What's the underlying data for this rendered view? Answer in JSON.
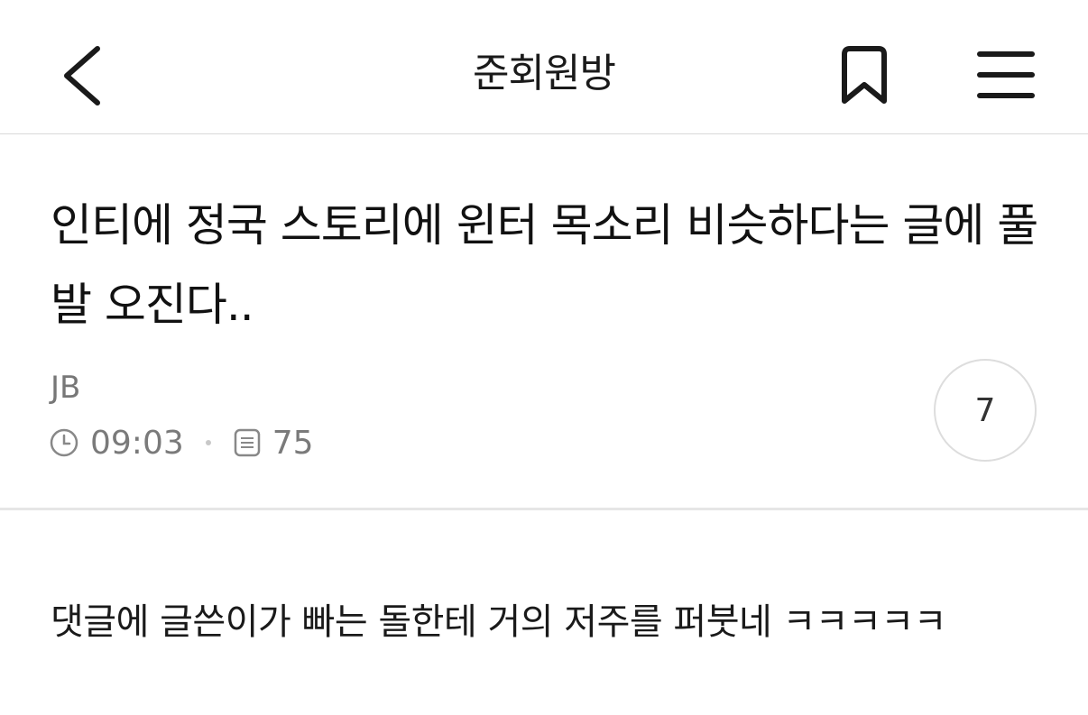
{
  "header": {
    "title": "준회원방",
    "icons": {
      "back": "chevron-left-icon",
      "bookmark": "bookmark-icon",
      "menu": "hamburger-menu-icon"
    }
  },
  "post": {
    "title": "인티에 정국 스토리에 윈터 목소리 비슷하다는 글에 풀발 오진다..",
    "author": "JB",
    "time": "09:03",
    "views": "75",
    "comment_count": "7",
    "body": "댓글에 글쓴이가 빠는 돌한테 거의 저주를 퍼붓네 ㅋㅋㅋㅋㅋ"
  },
  "colors": {
    "text": "#111111",
    "meta": "#777777",
    "divider": "#e6e6e6",
    "circle_border": "#dddddd"
  }
}
